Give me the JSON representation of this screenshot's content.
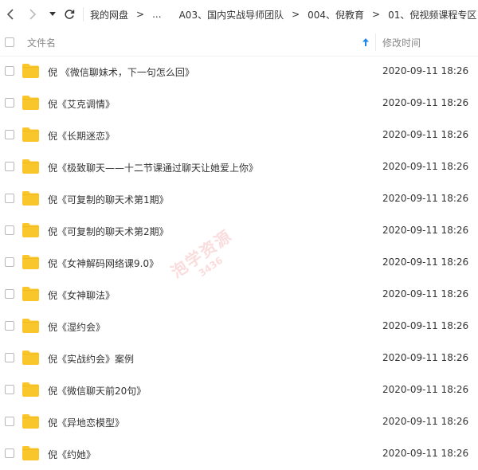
{
  "toolbar": {
    "breadcrumbs": [
      "我的网盘",
      "...",
      "A03、国内实战导师团队",
      "004、倪教育",
      "01、倪视频课程专区"
    ],
    "separator": ">"
  },
  "header": {
    "name_col": "文件名",
    "time_col": "修改时间"
  },
  "files": [
    {
      "name": "倪 《微信聊妹术，下一句怎么回》",
      "time": "2020-09-11 18:26"
    },
    {
      "name": "倪《艾克调情》",
      "time": "2020-09-11 18:26"
    },
    {
      "name": "倪《长期迷恋》",
      "time": "2020-09-11 18:26"
    },
    {
      "name": "倪《极致聊天——十二节课通过聊天让她爱上你》",
      "time": "2020-09-11 18:26"
    },
    {
      "name": "倪《可复制的聊天术第1期》",
      "time": "2020-09-11 18:26"
    },
    {
      "name": "倪《可复制的聊天术第2期》",
      "time": "2020-09-11 18:26"
    },
    {
      "name": "倪《女神解码网络课9.0》",
      "time": "2020-09-11 18:26"
    },
    {
      "name": "倪《女神聊法》",
      "time": "2020-09-11 18:26"
    },
    {
      "name": "倪《湿约会》",
      "time": "2020-09-11 18:26"
    },
    {
      "name": "倪《实战约会》案例",
      "time": "2020-09-11 18:26"
    },
    {
      "name": "倪《微信聊天前20句》",
      "time": "2020-09-11 18:26"
    },
    {
      "name": "倪《异地恋模型》",
      "time": "2020-09-11 18:26"
    },
    {
      "name": "倪《约她》",
      "time": "2020-09-11 18:26"
    }
  ],
  "watermark": {
    "line1": "泡学资源",
    "line2": "3436"
  },
  "colors": {
    "folder": "#f9c62b",
    "folder_tab": "#f2b51d",
    "sort_arrow": "#1e88e5"
  }
}
